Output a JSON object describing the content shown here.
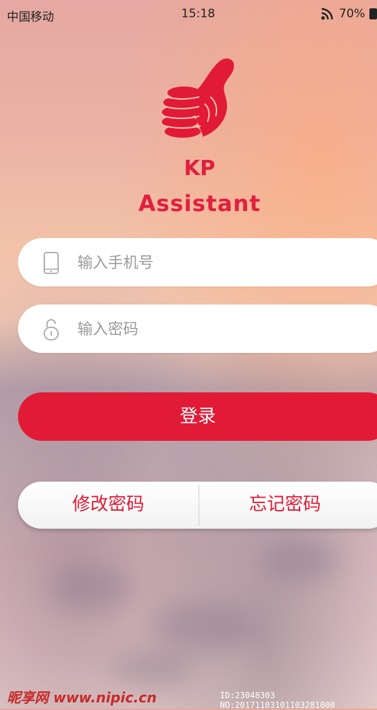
{
  "status_bar": {
    "carrier": "中国移动",
    "time": "15:18",
    "battery": "70%"
  },
  "app": {
    "name_line1": "KP",
    "name_line2": "Assistant",
    "logo_icon": "thumbs-up-coins-icon",
    "brand_color": "#e11a36"
  },
  "form": {
    "phone_placeholder": "输入手机号",
    "phone_value": "",
    "password_placeholder": "输入密码",
    "password_value": "",
    "login_label": "登录"
  },
  "actions": {
    "change_password_label": "修改密码",
    "forgot_password_label": "忘记密码"
  },
  "watermark": {
    "site": "昵享网 www.nipic.cn",
    "id_text": "ID:23048303 NO:20171103101103281000"
  }
}
